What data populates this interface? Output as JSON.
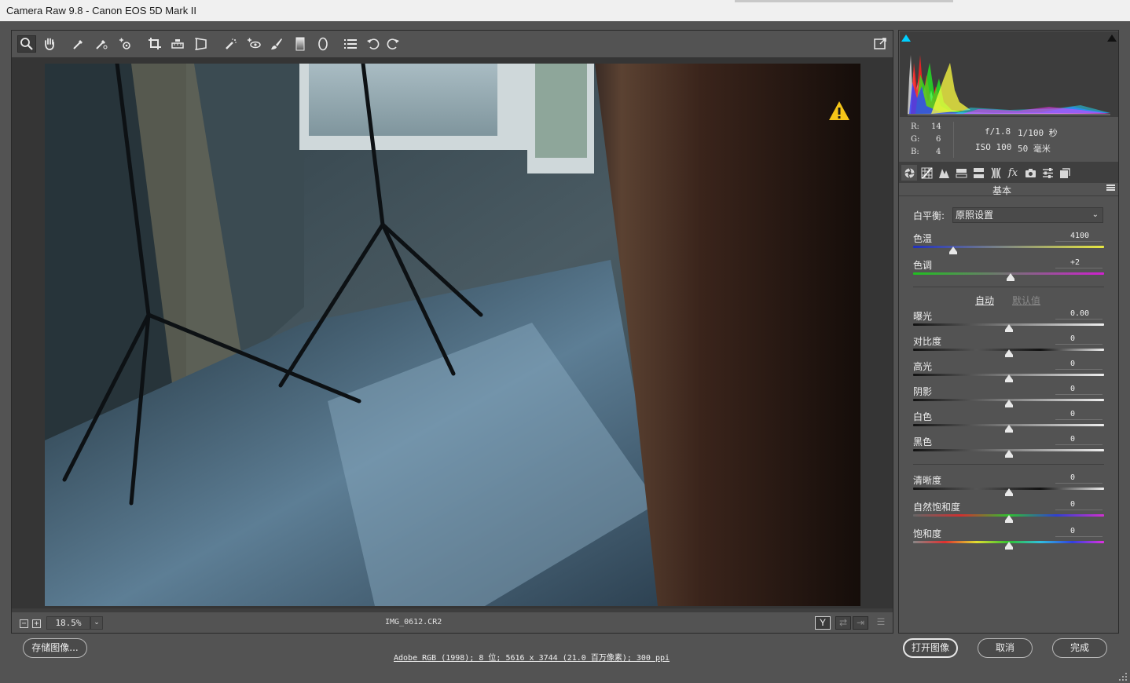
{
  "window": {
    "title": "Camera Raw 9.8 -  Canon EOS 5D Mark II"
  },
  "toolbar": {
    "tools": [
      "zoom-tool",
      "hand-tool",
      "white-balance-tool",
      "color-sampler-tool",
      "target-adjustment-tool",
      "crop-tool",
      "straighten-tool",
      "transform-tool",
      "spot-removal-tool",
      "red-eye-tool",
      "adjustment-brush-tool",
      "graduated-filter-tool",
      "radial-filter-tool",
      "preferences-tool",
      "rotate-left-tool",
      "rotate-right-tool"
    ],
    "active_tool": "zoom-tool",
    "fullscreen_icon": "fullscreen-icon"
  },
  "preview": {
    "warning_icon": "warning-icon",
    "zoom": "18.5%",
    "filename": "IMG_0612.CR2",
    "view_mode_label": "Y"
  },
  "info": {
    "r_label": "R:",
    "r_value": "14",
    "g_label": "G:",
    "g_value": "6",
    "b_label": "B:",
    "b_value": "4",
    "aperture": "f/1.8",
    "shutter": "1/100 秒",
    "iso": "ISO 100",
    "focal": "50 毫米"
  },
  "panel": {
    "tabs": [
      "basic-tab",
      "tone-curve-tab",
      "detail-tab",
      "hsl-tab",
      "split-toning-tab",
      "lens-corrections-tab",
      "effects-tab",
      "camera-calibration-tab",
      "presets-tab",
      "snapshots-tab"
    ],
    "active_tab": "basic-tab",
    "effects_tab_label": "fx",
    "section_title": "基本",
    "wb_label": "白平衡:",
    "wb_value": "原照设置",
    "auto_label": "自动",
    "default_label": "默认值",
    "sliders": [
      {
        "name": "色温",
        "value": "4100",
        "position": 0.21
      },
      {
        "name": "色调",
        "value": "+2",
        "position": 0.51
      },
      {
        "name": "曝光",
        "value": "0.00",
        "position": 0.5
      },
      {
        "name": "对比度",
        "value": "0",
        "position": 0.5
      },
      {
        "name": "高光",
        "value": "0",
        "position": 0.5
      },
      {
        "name": "阴影",
        "value": "0",
        "position": 0.5
      },
      {
        "name": "白色",
        "value": "0",
        "position": 0.5
      },
      {
        "name": "黑色",
        "value": "0",
        "position": 0.5
      },
      {
        "name": "清晰度",
        "value": "0",
        "position": 0.5
      },
      {
        "name": "自然饱和度",
        "value": "0",
        "position": 0.5
      },
      {
        "name": "饱和度",
        "value": "0",
        "position": 0.5
      }
    ]
  },
  "bottom": {
    "save_label": "存储图像...",
    "workflow_info": "Adobe RGB (1998); 8 位; 5616 x 3744 (21.0 百万像素); 300 ppi",
    "open_label": "打开图像",
    "cancel_label": "取消",
    "done_label": "完成"
  },
  "colors": {
    "background": "#535353",
    "preview_bg": "#353535",
    "warning": "#f5c518",
    "auto_link": "#e8e8e8",
    "default_link": "#8a8a8a"
  }
}
